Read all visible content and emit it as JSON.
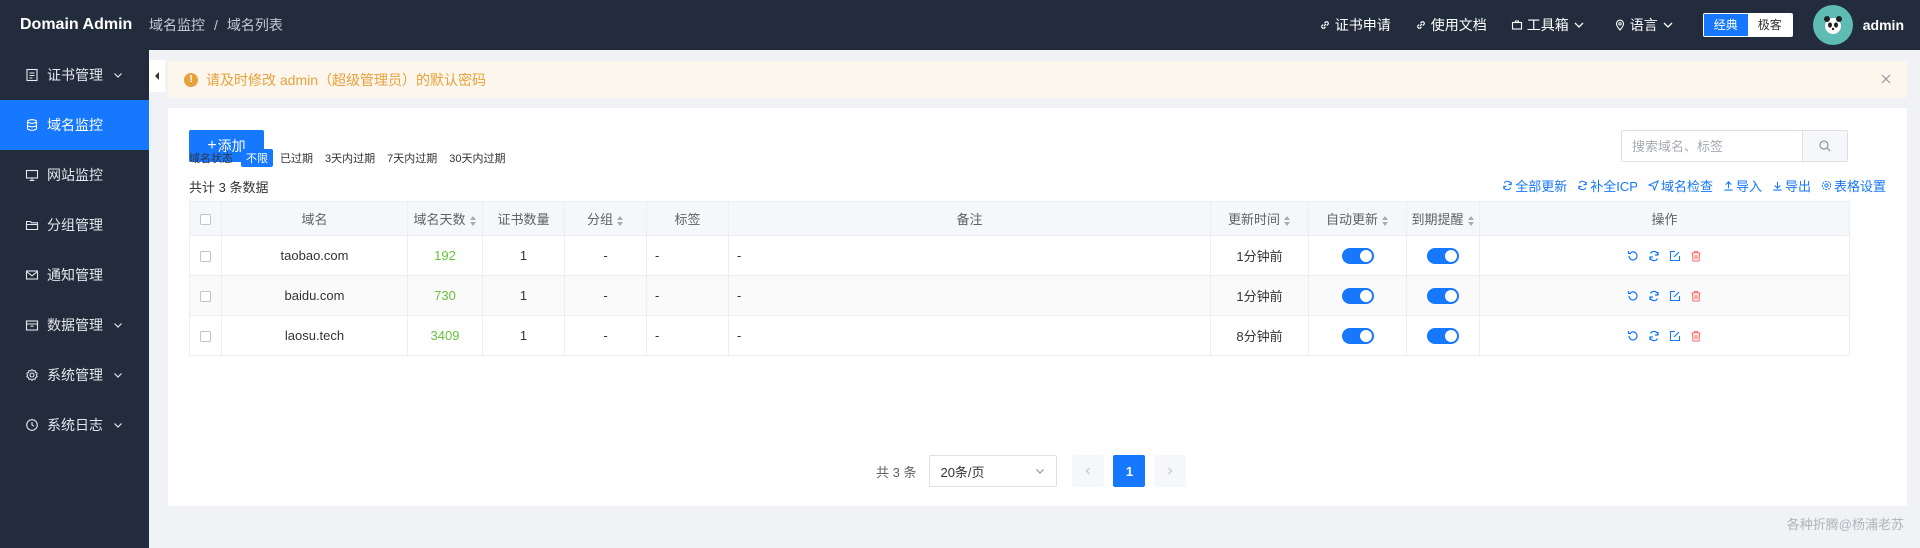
{
  "header": {
    "logo": "Domain Admin",
    "breadcrumb": [
      "域名监控",
      "域名列表"
    ],
    "breadcrumb_sep": "/",
    "links": {
      "cert_apply": "证书申请",
      "docs": "使用文档",
      "toolbox": "工具箱",
      "language": "语言"
    },
    "theme_options": {
      "classic": "经典",
      "minimal": "极客",
      "selected": "经典"
    },
    "username": "admin"
  },
  "sidebar": {
    "items": [
      {
        "label": "证书管理",
        "icon": "document-icon",
        "expandable": true
      },
      {
        "label": "域名监控",
        "icon": "database-icon",
        "expandable": false,
        "active": true
      },
      {
        "label": "网站监控",
        "icon": "monitor-icon",
        "expandable": false
      },
      {
        "label": "分组管理",
        "icon": "folder-icon",
        "expandable": false
      },
      {
        "label": "通知管理",
        "icon": "mail-icon",
        "expandable": false
      },
      {
        "label": "数据管理",
        "icon": "box-icon",
        "expandable": true
      },
      {
        "label": "系统管理",
        "icon": "gear-icon",
        "expandable": true
      },
      {
        "label": "系统日志",
        "icon": "clock-icon",
        "expandable": true
      }
    ]
  },
  "alert": {
    "text": "请及时修改 admin（超级管理员）的默认密码",
    "icon": "warning-icon"
  },
  "toolbar": {
    "add_label": "添加",
    "search_placeholder": "搜索域名、标签"
  },
  "filter": {
    "label": "域名状态",
    "options": [
      "不限",
      "已过期",
      "3天内过期",
      "7天内过期",
      "30天内过期"
    ],
    "selected": "不限"
  },
  "summary": {
    "total_text": "共计 3 条数据"
  },
  "actions": [
    "全部更新",
    "补全ICP",
    "域名检查",
    "导入",
    "导出",
    "表格设置"
  ],
  "table": {
    "columns": [
      "",
      "域名",
      "域名天数",
      "证书数量",
      "分组",
      "标签",
      "备注",
      "更新时间",
      "自动更新",
      "到期提醒",
      "操作"
    ],
    "rows": [
      {
        "domain": "taobao.com",
        "days": "192",
        "certs": "1",
        "group": "-",
        "tags": "-",
        "remark": "-",
        "updated": "1分钟前",
        "auto_update": true,
        "expire_notify": true
      },
      {
        "domain": "baidu.com",
        "days": "730",
        "certs": "1",
        "group": "-",
        "tags": "-",
        "remark": "-",
        "updated": "1分钟前",
        "auto_update": true,
        "expire_notify": true
      },
      {
        "domain": "laosu.tech",
        "days": "3409",
        "certs": "1",
        "group": "-",
        "tags": "-",
        "remark": "-",
        "updated": "8分钟前",
        "auto_update": true,
        "expire_notify": true
      }
    ]
  },
  "pagination": {
    "total_text": "共 3 条",
    "page_size": "20条/页",
    "current_page": "1"
  },
  "watermark": "各种折腾@杨浦老苏",
  "colors": {
    "primary": "#1677ff",
    "header_bg": "#232c3d",
    "warning": "#e6a23c",
    "success": "#67c23a",
    "danger": "#f56c6c"
  }
}
